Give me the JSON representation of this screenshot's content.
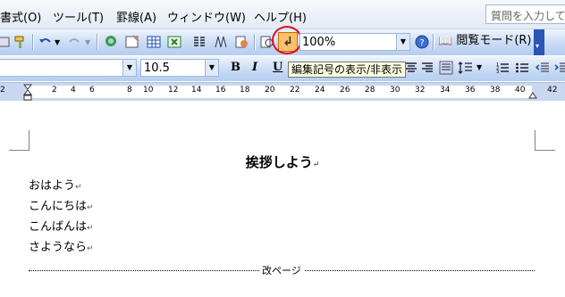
{
  "menu": {
    "items": [
      "書式(O)",
      "ツール(T)",
      "罫線(A)",
      "ウィンドウ(W)",
      "ヘルプ(H)"
    ],
    "help_placeholder": "質問を入力して"
  },
  "toolbar": {
    "zoom": "100%",
    "reading_mode": "閲覧モード(R)",
    "show_hide_icon": "pilcrow-icon",
    "font_size": "10.5",
    "bold": "B",
    "italic": "I",
    "underline": "U"
  },
  "tooltip": "編集記号の表示/非表示",
  "ruler": {
    "numbers": [
      "2",
      "2",
      "4",
      "6",
      "8",
      "10",
      "12",
      "14",
      "16",
      "18",
      "20",
      "22",
      "24",
      "26",
      "28",
      "30",
      "32",
      "34",
      "36",
      "38",
      "40",
      "42"
    ]
  },
  "document": {
    "title": "挨拶しよう",
    "lines": [
      "おはよう",
      "こんにちは",
      "こんばんは",
      "さようなら"
    ],
    "paragraph_mark": "↵",
    "page_break": "改ページ"
  },
  "colors": {
    "highlight_circle": "#e0101a",
    "active_button": "#ffc06b",
    "toolbar_end": "#2a55b7"
  }
}
